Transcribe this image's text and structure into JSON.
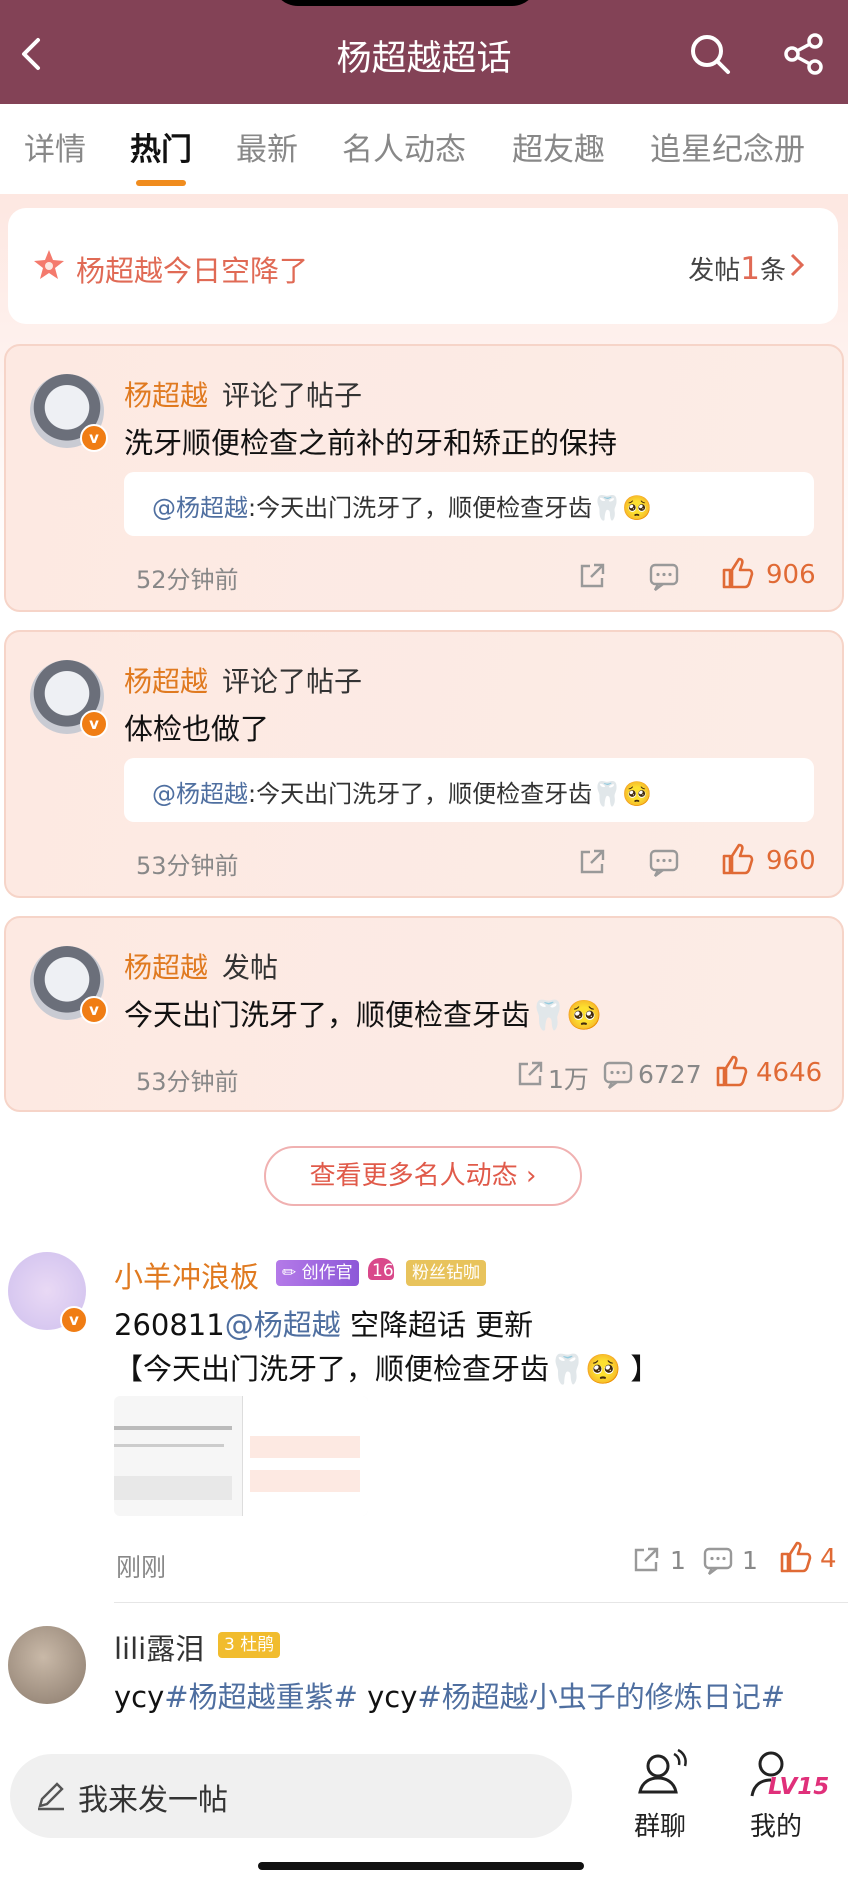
{
  "header": {
    "title": "杨超越超话",
    "back_icon": "back-arrow-icon",
    "search_icon": "search-icon",
    "share_icon": "share-icon"
  },
  "tabs": [
    {
      "label": "详情"
    },
    {
      "label": "热门"
    },
    {
      "label": "最新"
    },
    {
      "label": "名人动态"
    },
    {
      "label": "超友趣"
    },
    {
      "label": "追星纪念册"
    }
  ],
  "active_tab": "热门",
  "banner": {
    "text": "杨超越今日空降了",
    "count_prefix": "发帖",
    "count": "1",
    "count_suffix": "条"
  },
  "celebrity_posts": [
    {
      "name": "杨超越",
      "action": "评论了帖子",
      "content": "洗牙顺便检查之前补的牙和矫正的保持",
      "quote_mention": "@杨超越",
      "quote_text": ":今天出门洗牙了，顺便检查牙齿🦷🥺",
      "time": "52分钟前",
      "likes": "906"
    },
    {
      "name": "杨超越",
      "action": "评论了帖子",
      "content": "体检也做了",
      "quote_mention": "@杨超越",
      "quote_text": ":今天出门洗牙了，顺便检查牙齿🦷🥺",
      "time": "53分钟前",
      "likes": "960"
    },
    {
      "name": "杨超越",
      "action": "发帖",
      "content": "今天出门洗牙了，顺便检查牙齿🦷🥺",
      "time": "53分钟前",
      "shares": "1万",
      "comments": "6727",
      "likes": "4646"
    }
  ],
  "more_button": "查看更多名人动态",
  "feed": [
    {
      "name": "小羊冲浪板",
      "badge1": "创作官",
      "badge2": "粉丝钻咖",
      "level": "16",
      "line1_prefix": "260811",
      "line1_mention": "@杨超越",
      "line1_suffix": " 空降超话 更新",
      "line2": "【今天出门洗牙了，顺便检查牙齿🦷🥺 】",
      "time": "刚刚",
      "shares": "1",
      "comments": "1",
      "likes": "4"
    },
    {
      "name": "lili露泪",
      "badge1": "杜鹃",
      "level": "3",
      "text_p1": "ycy",
      "text_tag1": "#杨超越重紫#",
      "text_p2": " ycy",
      "text_tag2": "#杨超越小虫子的修炼日记#"
    }
  ],
  "bottom": {
    "input_placeholder": "我来发一帖",
    "group_label": "群聊",
    "mine_label": "我的",
    "level_badge": "LV15"
  },
  "colors": {
    "header_bg": "#834256",
    "accent": "#f08c1e",
    "like": "#e06a35",
    "link": "#4f6fa0"
  }
}
